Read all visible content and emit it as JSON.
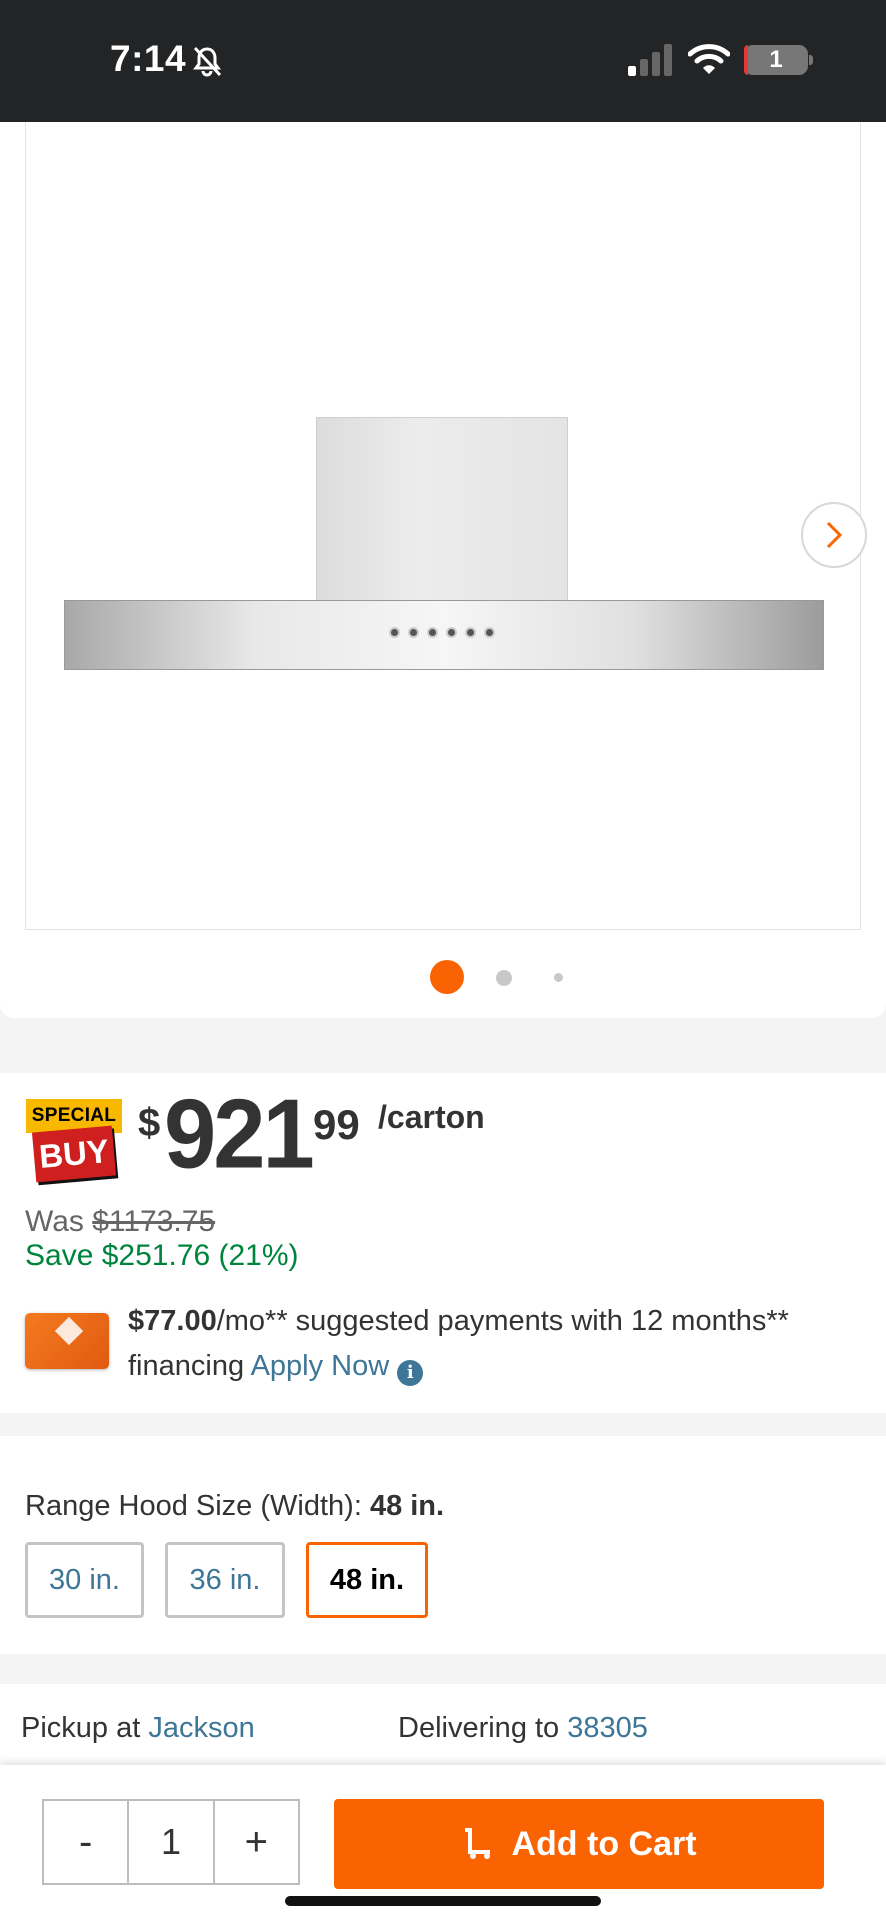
{
  "status_bar": {
    "time": "7:14",
    "battery": "1"
  },
  "gallery": {
    "active_index": 0,
    "total": 3
  },
  "price": {
    "badge_top": "SPECIAL",
    "badge_bottom": "BUY",
    "currency": "$",
    "dollars": "921",
    "cents": "99",
    "unit": "/carton",
    "was_label": "Was",
    "was_price": "$1173.75",
    "save_text": "Save $251.76 (21%)"
  },
  "financing": {
    "amount": "$77.00",
    "text": "/mo** suggested payments with 12 months** financing",
    "link": "Apply Now",
    "info_glyph": "i"
  },
  "size_selector": {
    "label": "Range Hood Size (Width):",
    "selected": "48 in.",
    "options": [
      "30 in.",
      "36 in.",
      "48 in."
    ]
  },
  "fulfillment": {
    "pickup_label": "Pickup at",
    "pickup_store": "Jackson",
    "delivery_label": "Delivering to",
    "delivery_zip": "38305"
  },
  "cart": {
    "minus": "-",
    "quantity": "1",
    "plus": "+",
    "add_label": "Add to Cart"
  },
  "colors": {
    "brand": "#f96302",
    "link": "#3e7697",
    "save": "#00843d",
    "badge_yellow": "#f9b800",
    "badge_red": "#d01f1f"
  }
}
